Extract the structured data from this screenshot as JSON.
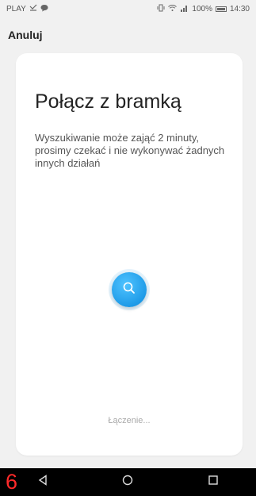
{
  "status_bar": {
    "carrier": "PLAY",
    "battery_text": "100%",
    "time": "14:30"
  },
  "top_bar": {
    "cancel_label": "Anuluj"
  },
  "card": {
    "title": "Połącz z bramką",
    "description": "Wyszukiwanie może zająć 2 minuty, prosimy czekać i nie wykonywać żadnych innych działań",
    "status_text": "Łączenie..."
  },
  "nav_bar": {
    "annotation_number": "6"
  },
  "colors": {
    "accent": "#1e9be8",
    "background": "#f1f1f1",
    "annotation": "#ff2a2a"
  }
}
